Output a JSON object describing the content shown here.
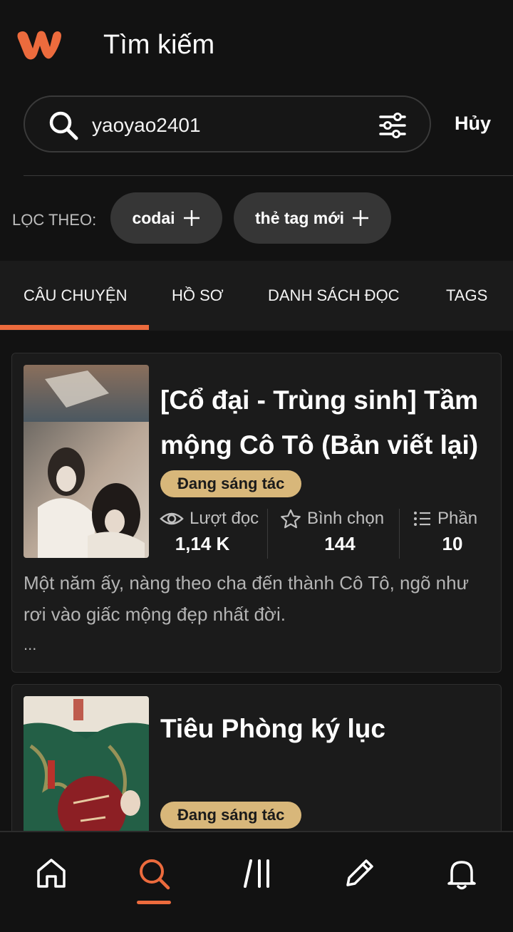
{
  "header": {
    "title": "Tìm kiếm",
    "logo_icon": "wattpad-logo"
  },
  "search": {
    "value": "yaoyao2401",
    "cancel_label": "Hủy"
  },
  "filters": {
    "label": "LỌC THEO:",
    "chips": [
      {
        "label": "codai"
      },
      {
        "label": "thẻ tag mới"
      }
    ]
  },
  "tabs": [
    {
      "label": "CÂU CHUYỆN",
      "active": true
    },
    {
      "label": "HỒ SƠ",
      "active": false
    },
    {
      "label": "DANH SÁCH ĐỌC",
      "active": false
    },
    {
      "label": "TAGS",
      "active": false
    }
  ],
  "results": [
    {
      "title": "[Cổ đại - Trùng sinh] Tầm mộng Cô Tô (Bản viết lại)",
      "status": "Đang sáng tác",
      "stats": {
        "reads_label": "Lượt đọc",
        "reads_value": "1,14 K",
        "votes_label": "Bình chọn",
        "votes_value": "144",
        "parts_label": "Phần",
        "parts_value": "10"
      },
      "description": "Một năm ấy, nàng theo cha đến thành Cô Tô, ngõ như rơi vào giấc mộng đẹp nhất đời.",
      "ellipsis": "..."
    },
    {
      "title": "Tiêu Phòng ký lục",
      "status": "Đang sáng tác"
    }
  ],
  "nav": [
    {
      "icon": "home-icon",
      "active": false
    },
    {
      "icon": "search-icon",
      "active": true
    },
    {
      "icon": "library-icon",
      "active": false
    },
    {
      "icon": "write-icon",
      "active": false
    },
    {
      "icon": "bell-icon",
      "active": false
    }
  ],
  "colors": {
    "accent": "#ec6b3d",
    "badge": "#d8b77a",
    "background": "#121212",
    "card": "#1b1b1b"
  }
}
